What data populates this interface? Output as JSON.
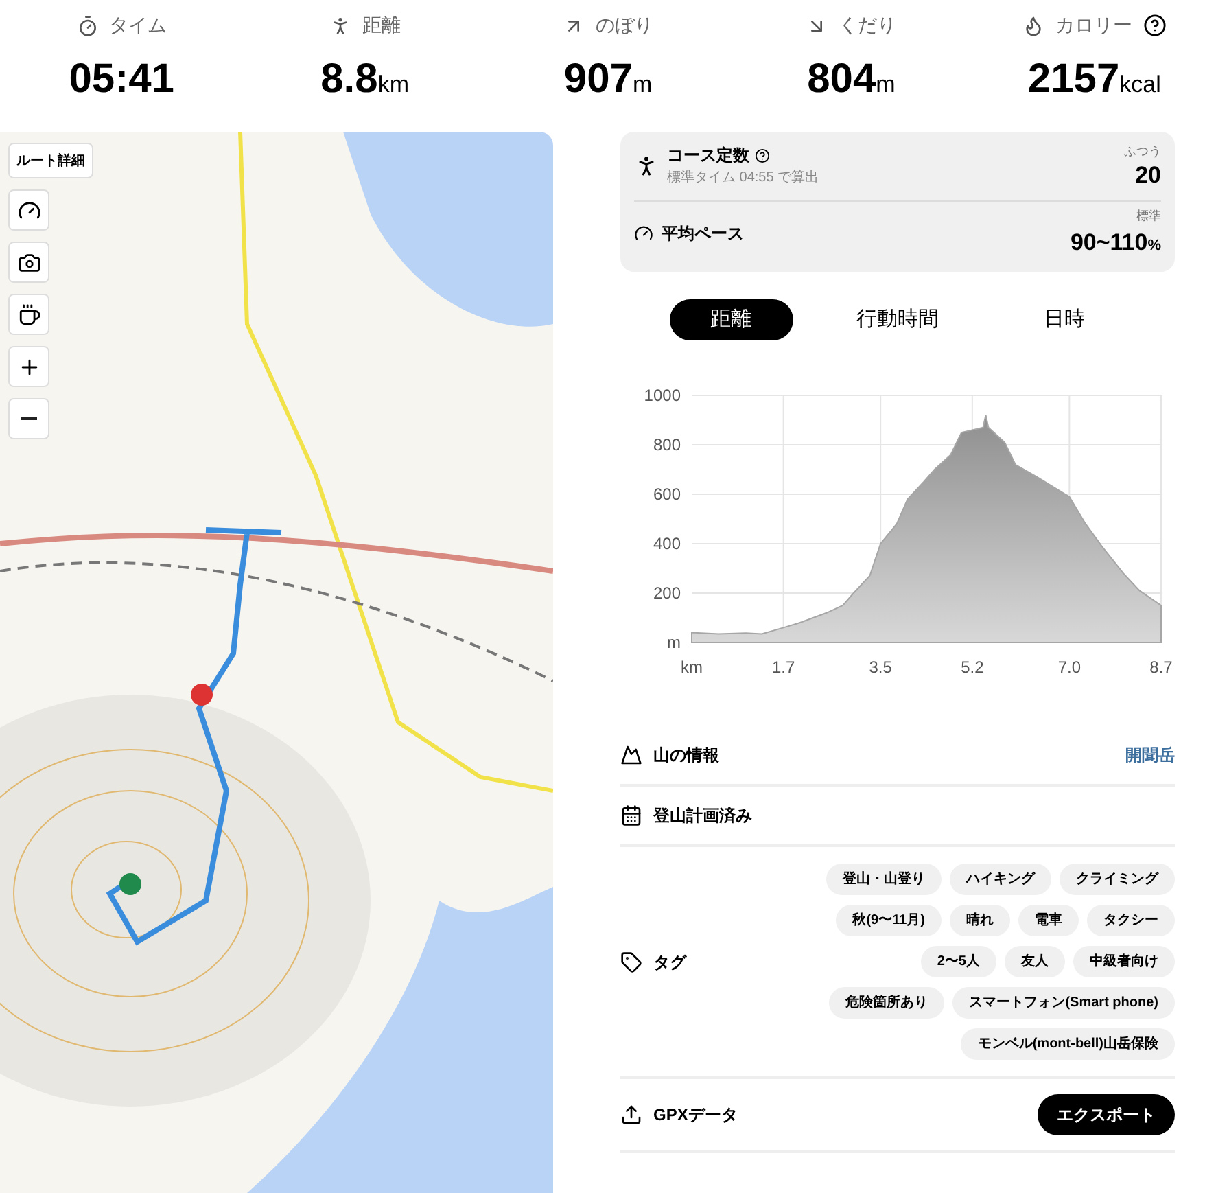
{
  "stats": [
    {
      "label": "タイム",
      "value": "05:41",
      "help": false
    },
    {
      "label": "距離",
      "value": "8.8",
      "unit": "km",
      "help": false
    },
    {
      "label": "のぼり",
      "value": "907",
      "unit": "m",
      "help": false
    },
    {
      "label": "くだり",
      "value": "804",
      "unit": "m",
      "help": false
    },
    {
      "label": "カロリー",
      "value": "2157",
      "unit": "kcal",
      "help": true
    }
  ],
  "map": {
    "kind": "picture",
    "route_button": "ルート詳細"
  },
  "course_constant": {
    "title": "コース定数",
    "subtitle": "標準タイム 04:55 で算出",
    "grade": "ふつう",
    "value": "20"
  },
  "average_pace": {
    "title": "平均ペース",
    "grade": "標準",
    "value": "90~110",
    "unit": "%"
  },
  "tabs": [
    {
      "label": "距離",
      "selected": true
    },
    {
      "label": "行動時間",
      "selected": false
    },
    {
      "label": "日時",
      "selected": false
    }
  ],
  "elevation": {
    "chart_data": {
      "type": "area",
      "xlabel": "km",
      "ylabel": "m",
      "grid": true,
      "x": [
        0,
        0.5,
        1.0,
        1.3,
        1.7,
        2.0,
        2.5,
        2.8,
        3.0,
        3.3,
        3.5,
        3.8,
        4.0,
        4.3,
        4.5,
        4.8,
        5.0,
        5.2,
        5.4,
        5.45,
        5.5,
        5.8,
        6.0,
        6.4,
        7.0,
        7.3,
        7.6,
        8.0,
        8.3,
        8.7
      ],
      "series": [
        {
          "color": "#a6a6a6",
          "values": [
            40,
            35,
            38,
            35,
            60,
            80,
            120,
            150,
            200,
            270,
            400,
            480,
            580,
            650,
            700,
            760,
            850,
            860,
            870,
            920,
            870,
            810,
            720,
            670,
            590,
            480,
            390,
            280,
            210,
            150
          ]
        }
      ],
      "xlim": [
        0,
        8.7
      ],
      "ylim": [
        0,
        1000
      ],
      "xticks": [
        1.7,
        3.5,
        5.2,
        {
          "value": 7.0,
          "label": "7.0"
        },
        8.7
      ],
      "yticks": [
        200,
        400,
        600,
        800,
        1000
      ]
    }
  },
  "mountain_info": {
    "label": "山の情報",
    "value": "開聞岳"
  },
  "plan": {
    "label": "登山計画済み"
  },
  "tags": {
    "label": "タグ",
    "items": [
      "登山・山登り",
      "ハイキング",
      "クライミング",
      "秋(9〜11月)",
      "晴れ",
      "電車",
      "タクシー",
      "2〜5人",
      "友人",
      "中級者向け",
      "危険箇所あり",
      "スマートフォン(Smart phone)",
      "モンベル(mont-bell)山岳保険"
    ]
  },
  "gpx": {
    "label": "GPXデータ",
    "button": "エクスポート"
  }
}
